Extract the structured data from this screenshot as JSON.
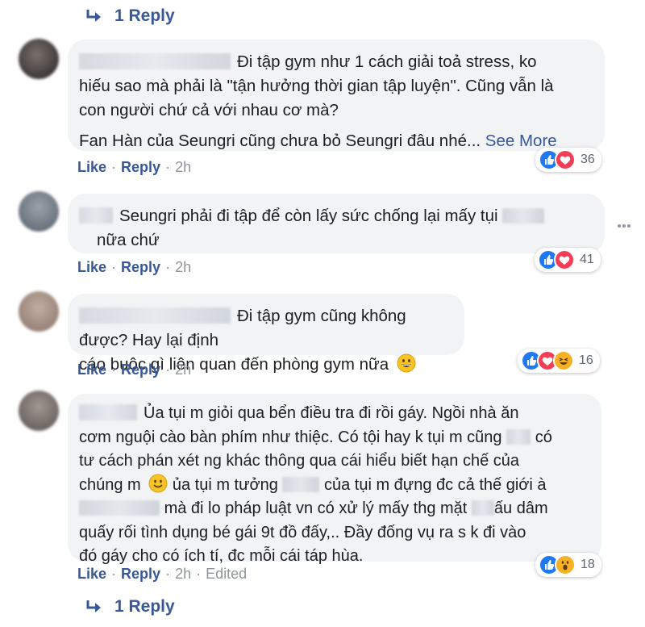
{
  "top_reply": {
    "label": "1 Reply"
  },
  "bottom_reply": {
    "label": "1 Reply"
  },
  "actions": {
    "like": "Like",
    "reply": "Reply",
    "separator": "·",
    "edited": "Edited"
  },
  "colors": {
    "link": "#385898",
    "bubble": "#f2f3f5",
    "like": "#2078f4",
    "love": "#f33e58",
    "haha": "#f7b125"
  },
  "comments": [
    {
      "lines": [
        "Đi tập gym như 1 cách giải toả stress, ko",
        "hiếu sao mà phải là \"tận hưởng thời gian tập luyện\". Cũng vẫn là",
        "con người chứ cả với nhau cơ mà?",
        "Fan Hàn của Seungri cũng chưa bỏ Seungri đâu nhé..."
      ],
      "see_more": "See More",
      "time": "2h",
      "reactions": [
        "like-icon",
        "love-icon"
      ],
      "reaction_count": "36"
    },
    {
      "lines": [
        "Seungri phải đi tập để còn lấy sức chống lại mấy tụi",
        "nữa chứ"
      ],
      "time": "2h",
      "reactions": [
        "like-icon",
        "love-icon"
      ],
      "reaction_count": "41"
    },
    {
      "lines": [
        "Đi tập gym cũng không được? Hay lại định",
        "cáo buộc gì liên quan đến phòng gym nữa"
      ],
      "time": "2h",
      "reactions": [
        "like-icon",
        "love-icon",
        "haha-icon"
      ],
      "reaction_count": "16"
    },
    {
      "lines": [
        "Ủa tụi m giỏi qua bển điều tra đi rồi gáy. Ngồi nhà ăn",
        "cơm nguội cào bàn phím như thiệc. Có tội hay k tụi m cũng",
        "có",
        "tư cách phán xét ng khác thông qua cái hiểu biết hạn chế của",
        "chúng m",
        "ủa tụi m tưởng",
        "của tụi m đựng đc cả thế giới à",
        "mà đi lo pháp luật vn có xử lý mấy thg mặt",
        "ấu dâm",
        "quấy rối tình dụng bé gái 9t đồ đấy,.. Đầy đống vụ ra s k đi vào",
        "đó gáy cho có ích tí, đc mỗi cái táp hùa."
      ],
      "time": "2h",
      "reactions": [
        "like-icon",
        "wow-icon"
      ],
      "reaction_count": "18"
    }
  ]
}
